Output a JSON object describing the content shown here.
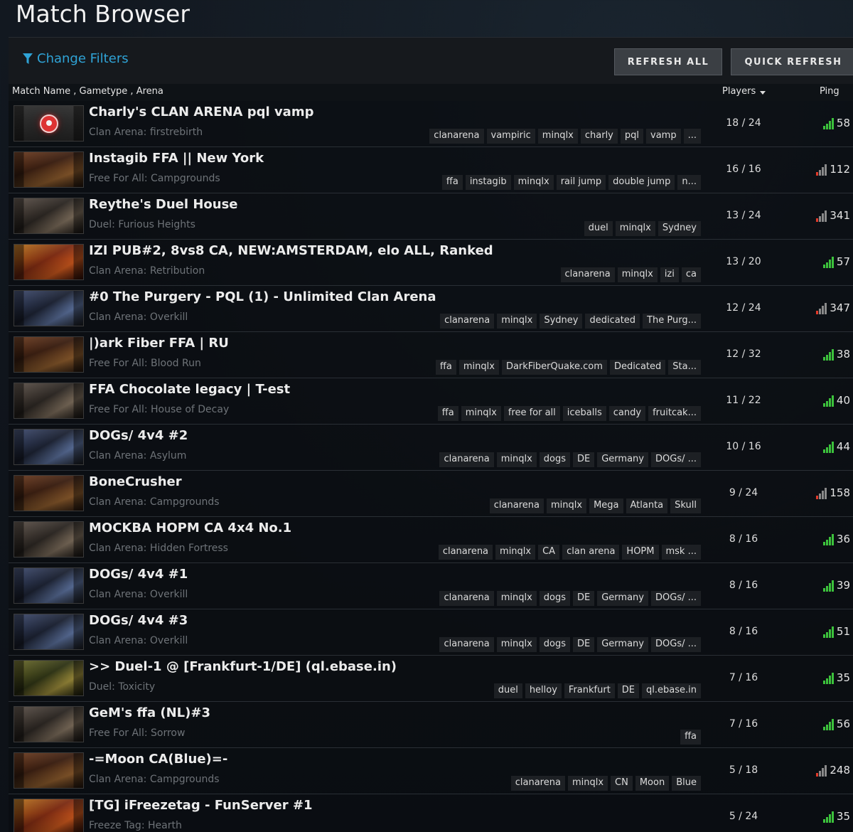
{
  "header": {
    "title": "Match Browser"
  },
  "filters": {
    "change_filters_label": "Change Filters",
    "refresh_all_label": "REFRESH ALL",
    "quick_refresh_label": "QUICK REFRESH"
  },
  "columns": {
    "name_label": "Match Name ,  Gametype ,  Arena",
    "players_label": "Players",
    "ping_label": "Ping"
  },
  "colors": {
    "accent": "#2fa3d6",
    "ping_good": "#3cc23c",
    "ping_bad": "#e23a2a"
  },
  "matches": [
    {
      "name": "Charly's CLAN ARENA pql vamp",
      "mode": "Clan Arena: firstrebirth",
      "tags": [
        "clanarena",
        "vampiric",
        "minqlx",
        "charly",
        "pql",
        "vamp",
        "..."
      ],
      "players": "18 / 24",
      "ping": "58",
      "ping_quality": "good",
      "thumb": "logo"
    },
    {
      "name": "Instagib FFA || New York",
      "mode": "Free For All: Campgrounds",
      "tags": [
        "ffa",
        "instagib",
        "minqlx",
        "rail jump",
        "double jump",
        "n..."
      ],
      "players": "16 / 16",
      "ping": "112",
      "ping_quality": "bad",
      "thumb": "warm"
    },
    {
      "name": "Reythe's Duel House",
      "mode": "Duel: Furious Heights",
      "tags": [
        "duel",
        "minqlx",
        "Sydney"
      ],
      "players": "13 / 24",
      "ping": "341",
      "ping_quality": "bad",
      "thumb": "grey"
    },
    {
      "name": "IZI PUB#2, 8vs8 CA, NEW:AMSTERDAM, elo ALL, Ranked",
      "mode": "Clan Arena: Retribution",
      "tags": [
        "clanarena",
        "minqlx",
        "izi",
        "ca"
      ],
      "players": "13 / 20",
      "ping": "57",
      "ping_quality": "good",
      "thumb": "red"
    },
    {
      "name": "#0 The Purgery - PQL (1) - Unlimited Clan Arena",
      "mode": "Clan Arena: Overkill",
      "tags": [
        "clanarena",
        "minqlx",
        "Sydney",
        "dedicated",
        "The Purg..."
      ],
      "players": "12 / 24",
      "ping": "347",
      "ping_quality": "bad",
      "thumb": "blue"
    },
    {
      "name": "|)ark Fiber FFA | RU",
      "mode": "Free For All: Blood Run",
      "tags": [
        "ffa",
        "minqlx",
        "DarkFiberQuake.com",
        "Dedicated",
        "Sta..."
      ],
      "players": "12 / 32",
      "ping": "38",
      "ping_quality": "good",
      "thumb": "warm"
    },
    {
      "name": "FFA Chocolate legacy | T-est",
      "mode": "Free For All: House of Decay",
      "tags": [
        "ffa",
        "minqlx",
        "free for all",
        "iceballs",
        "candy",
        "fruitcak..."
      ],
      "players": "11 / 22",
      "ping": "40",
      "ping_quality": "good",
      "thumb": "grey"
    },
    {
      "name": "DOGs/ 4v4 #2",
      "mode": "Clan Arena: Asylum",
      "tags": [
        "clanarena",
        "minqlx",
        "dogs",
        "DE",
        "Germany",
        "DOGs/ ..."
      ],
      "players": "10 / 16",
      "ping": "44",
      "ping_quality": "good",
      "thumb": "blue"
    },
    {
      "name": "BoneCrusher",
      "mode": "Clan Arena: Campgrounds",
      "tags": [
        "clanarena",
        "minqlx",
        "Mega",
        "Atlanta",
        "Skull"
      ],
      "players": "9 / 24",
      "ping": "158",
      "ping_quality": "bad",
      "thumb": "warm"
    },
    {
      "name": "MOCKBA HOPM CA 4x4 No.1",
      "mode": "Clan Arena: Hidden Fortress",
      "tags": [
        "clanarena",
        "minqlx",
        "CA",
        "clan arena",
        "HOPM",
        "msk ..."
      ],
      "players": "8 / 16",
      "ping": "36",
      "ping_quality": "good",
      "thumb": "grey"
    },
    {
      "name": "DOGs/ 4v4 #1",
      "mode": "Clan Arena: Overkill",
      "tags": [
        "clanarena",
        "minqlx",
        "dogs",
        "DE",
        "Germany",
        "DOGs/ ..."
      ],
      "players": "8 / 16",
      "ping": "39",
      "ping_quality": "good",
      "thumb": "blue"
    },
    {
      "name": "DOGs/ 4v4 #3",
      "mode": "Clan Arena: Overkill",
      "tags": [
        "clanarena",
        "minqlx",
        "dogs",
        "DE",
        "Germany",
        "DOGs/ ..."
      ],
      "players": "8 / 16",
      "ping": "51",
      "ping_quality": "good",
      "thumb": "blue"
    },
    {
      "name": ">> Duel-1 @ [Frankfurt-1/DE] (ql.ebase.in)",
      "mode": "Duel: Toxicity",
      "tags": [
        "duel",
        "helloy",
        "Frankfurt",
        "DE",
        "ql.ebase.in"
      ],
      "players": "7 / 16",
      "ping": "35",
      "ping_quality": "good",
      "thumb": "green"
    },
    {
      "name": "GeM's ffa (NL)#3",
      "mode": "Free For All: Sorrow",
      "tags": [
        "ffa"
      ],
      "players": "7 / 16",
      "ping": "56",
      "ping_quality": "good",
      "thumb": "grey"
    },
    {
      "name": "-=Moon CA(Blue)=-",
      "mode": "Clan Arena: Campgrounds",
      "tags": [
        "clanarena",
        "minqlx",
        "CN",
        "Moon",
        "Blue"
      ],
      "players": "5 / 18",
      "ping": "248",
      "ping_quality": "bad",
      "thumb": "warm"
    },
    {
      "name": "[TG] iFreezetag - FunServer #1",
      "mode": "Freeze Tag: Hearth",
      "tags": [],
      "players": "5 / 24",
      "ping": "35",
      "ping_quality": "good",
      "thumb": "red"
    }
  ]
}
